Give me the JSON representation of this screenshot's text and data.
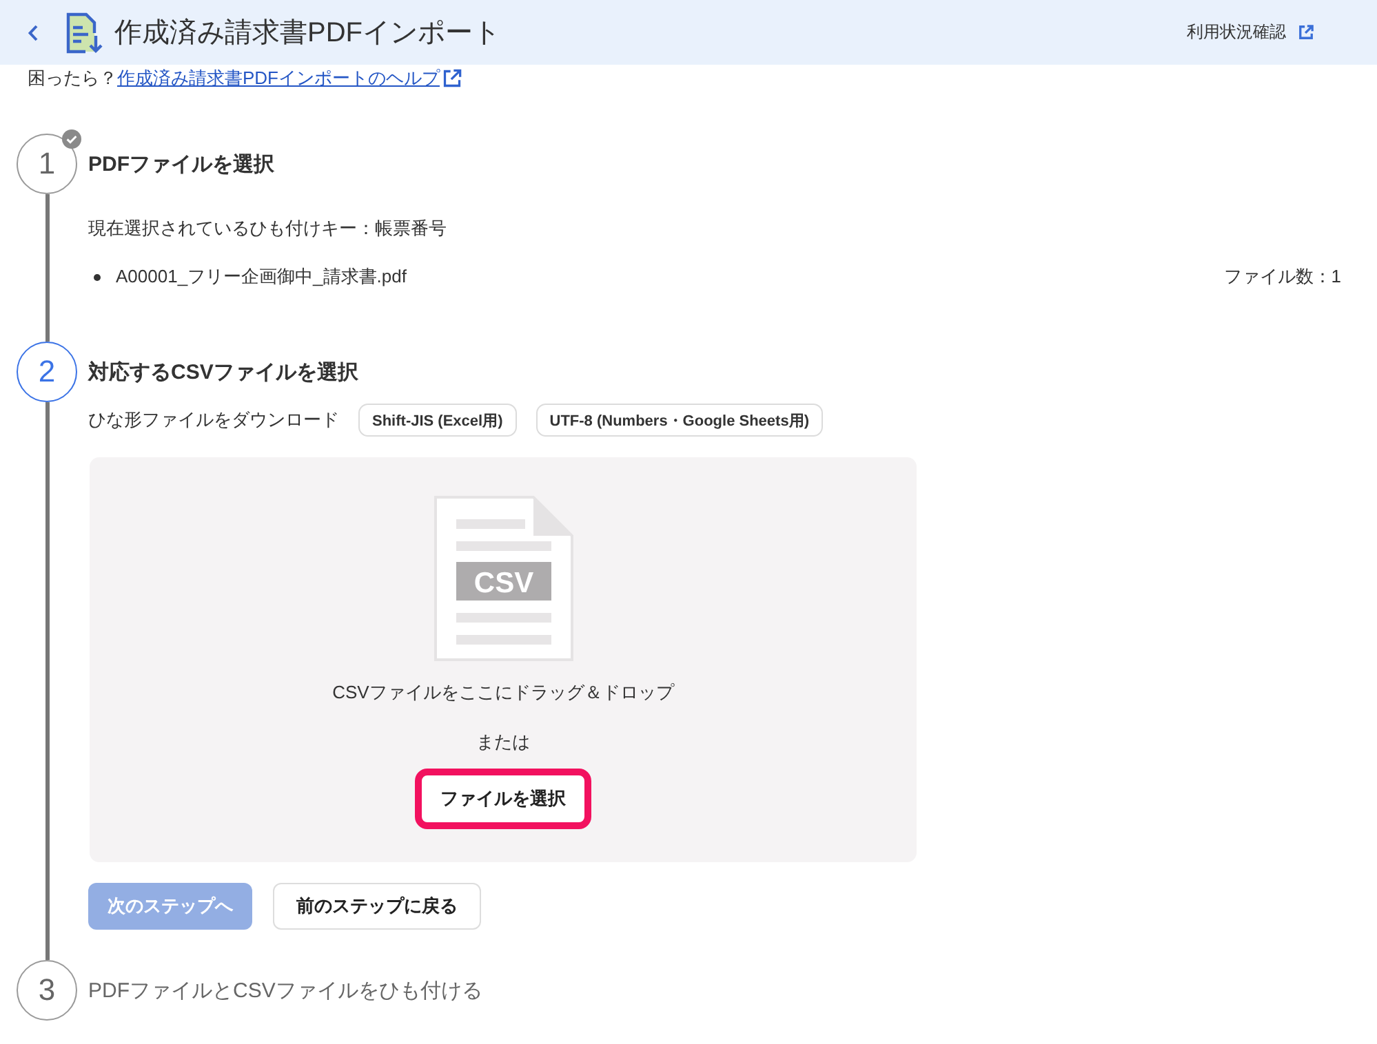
{
  "header": {
    "title": "作成済み請求書PDFインポート",
    "usage_link": "利用状況確認"
  },
  "help": {
    "prompt": "困ったら？",
    "link": "作成済み請求書PDFインポートのヘルプ"
  },
  "steps": [
    {
      "number": "1",
      "title": "PDFファイルを選択",
      "completed": true,
      "active": false,
      "key_info": "現在選択されているひも付けキー：帳票番号",
      "files": [
        "A00001_フリー企画御中_請求書.pdf"
      ],
      "file_count": "ファイル数：1"
    },
    {
      "number": "2",
      "title": "対応するCSVファイルを選択",
      "completed": false,
      "active": true,
      "template": {
        "label": "ひな形ファイルをダウンロード",
        "buttons": [
          "Shift-JIS (Excel用)",
          "UTF-8 (Numbers・Google Sheets用)"
        ]
      },
      "dropzone": {
        "file_type": "CSV",
        "prompt": "CSVファイルをここにドラッグ＆ドロップ",
        "separator": "または",
        "button": {
          "label": "ファイルを選択",
          "highlighted": true
        }
      },
      "actions": [
        {
          "label": "次のステップへ",
          "kind": "primary",
          "disabled": true
        },
        {
          "label": "前のステップに戻る",
          "kind": "secondary",
          "disabled": false
        }
      ]
    },
    {
      "number": "3",
      "title": "PDFファイルとCSVファイルをひも付ける",
      "completed": false,
      "active": false
    }
  ]
}
